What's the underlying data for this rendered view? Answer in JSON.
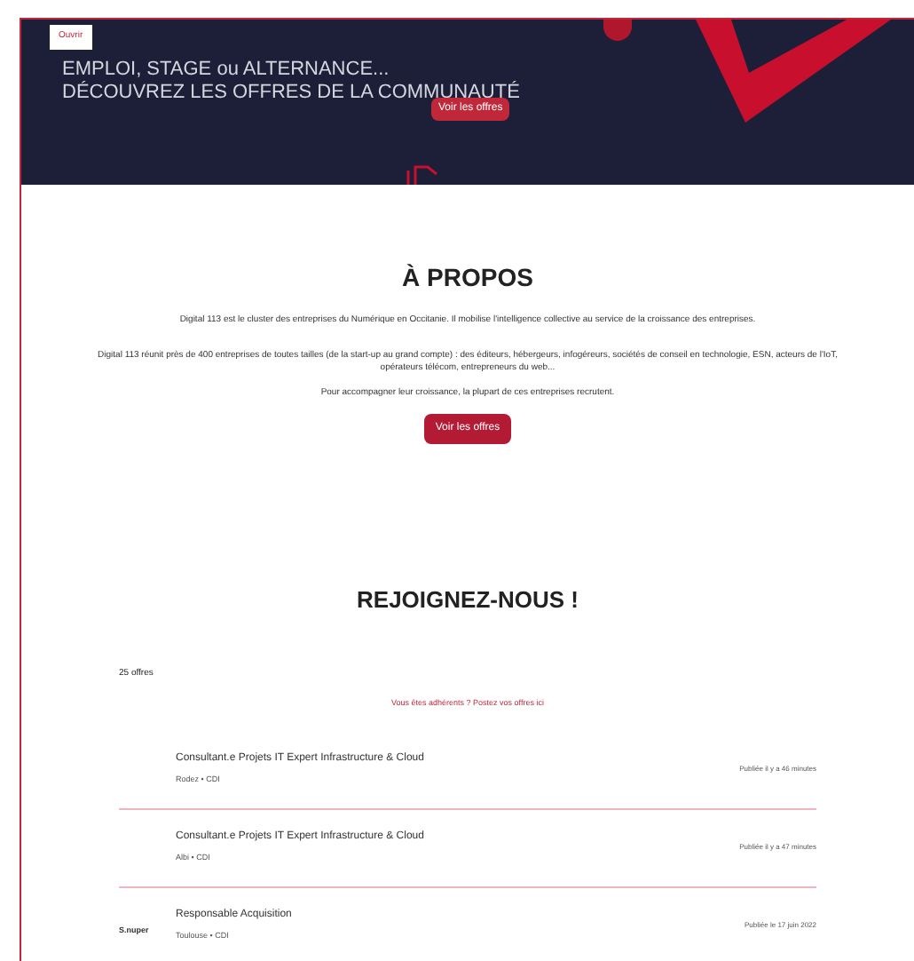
{
  "hero": {
    "badge": "Ouvrir",
    "title_lines": [
      "EMPLOI, STAGE ou ALTERNANCE...",
      "DÉCOUVREZ LES OFFRES DE LA COMMUNAUTÉ"
    ],
    "button": "Voir les offres"
  },
  "about": {
    "heading": "À PROPOS",
    "paragraphs": [
      "Digital 113 est le cluster des entreprises du Numérique en Occitanie. Il mobilise l'intelligence collective au service de la croissance des entreprises.",
      "Digital 113 réunit près de 400 entreprises de toutes tailles (de la start-up au grand compte) : des éditeurs, hébergeurs, infogéreurs, sociétés de conseil en technologie, ESN, acteurs de l'IoT, opérateurs télécom, entrepreneurs du web...",
      "Pour accompagner leur croissance, la plupart de ces entreprises recrutent."
    ],
    "button": "Voir les offres"
  },
  "join": {
    "heading": "REJOIGNEZ-NOUS !",
    "count": "25 offres",
    "link": "Vous êtes adhérents ? Postez vos offres ici",
    "offers": [
      {
        "title": "Consultant.e Projets IT Expert Infrastructure & Cloud",
        "meta": "Rodez • CDI",
        "date": "Publiée il y a 46 minutes"
      },
      {
        "title": "Consultant.e Projets IT Expert Infrastructure & Cloud",
        "meta": "Albi • CDI",
        "date": "Publiée il y a 47 minutes"
      },
      {
        "company": "S.nuper",
        "title": "Responsable Acquisition",
        "meta": "Toulouse • CDI",
        "date": "Publiée le 17 juin 2022"
      }
    ]
  }
}
